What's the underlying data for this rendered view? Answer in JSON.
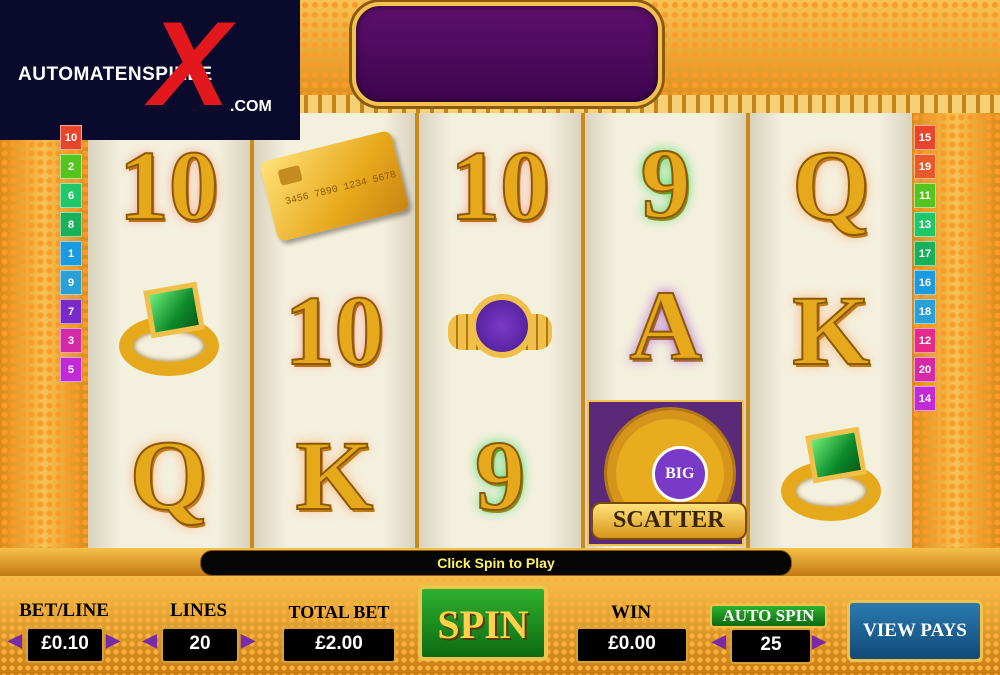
{
  "logo": {
    "main": "AUTOMATENSPIELE",
    "x": "X",
    "domain": ".COM"
  },
  "markers_left": [
    {
      "n": "10",
      "color": "#e8452a"
    },
    {
      "n": "2",
      "color": "#55c41e"
    },
    {
      "n": "6",
      "color": "#1ec86a"
    },
    {
      "n": "8",
      "color": "#19b05a"
    },
    {
      "n": "1",
      "color": "#1a9adf"
    },
    {
      "n": "9",
      "color": "#2aa0d8"
    },
    {
      "n": "7",
      "color": "#7a2ac8"
    },
    {
      "n": "3",
      "color": "#d52aa8"
    },
    {
      "n": "5",
      "color": "#c22ad8"
    }
  ],
  "markers_right": [
    {
      "n": "15",
      "color": "#e8452a"
    },
    {
      "n": "19",
      "color": "#e85a2a"
    },
    {
      "n": "11",
      "color": "#55c41e"
    },
    {
      "n": "13",
      "color": "#1ec86a"
    },
    {
      "n": "17",
      "color": "#19b05a"
    },
    {
      "n": "16",
      "color": "#1a9adf"
    },
    {
      "n": "18",
      "color": "#2aa0d8"
    },
    {
      "n": "12",
      "color": "#e42a8a"
    },
    {
      "n": "20",
      "color": "#d52aa8"
    },
    {
      "n": "14",
      "color": "#c22ad8"
    }
  ],
  "reels": [
    [
      "10",
      "ring",
      "Q"
    ],
    [
      "card",
      "10",
      "K"
    ],
    [
      "10",
      "watch",
      "9"
    ],
    [
      "9",
      "A",
      "scatter"
    ],
    [
      "Q",
      "K",
      "ring"
    ]
  ],
  "card": {
    "number": "3456 7890 1234 5678"
  },
  "scatter": {
    "logo": "BIG",
    "label": "SCATTER"
  },
  "message": "Click Spin to Play",
  "controls": {
    "bet_line_label": "BET/LINE",
    "bet_line_value": "£0.10",
    "lines_label": "LINES",
    "lines_value": "20",
    "total_bet_label": "TOTAL BET",
    "total_bet_value": "£2.00",
    "spin_label": "SPIN",
    "win_label": "WIN",
    "win_value": "£0.00",
    "auto_spin_label": "AUTO SPIN",
    "auto_spin_value": "25",
    "view_pays_label": "VIEW PAYS"
  }
}
